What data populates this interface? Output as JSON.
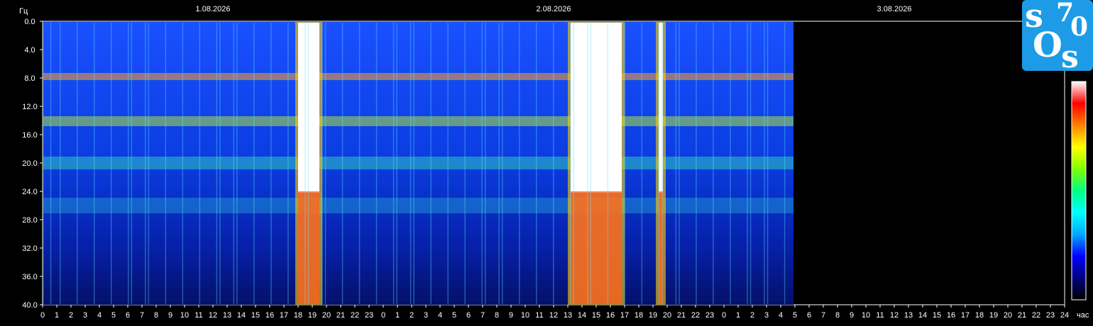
{
  "chart_data": {
    "type": "heatmap",
    "title": "",
    "ylabel": "Гц",
    "xlabel": "час",
    "ylim": [
      0,
      40
    ],
    "y_ticks": [
      "0.0",
      "4.0",
      "8.0",
      "12.0",
      "16.0",
      "20.0",
      "24.0",
      "28.0",
      "32.0",
      "36.0",
      "40.0"
    ],
    "dates": [
      "1.08.2026",
      "2.08.2026",
      "3.08.2026"
    ],
    "x_ticks": [
      "0",
      "1",
      "2",
      "3",
      "4",
      "5",
      "6",
      "7",
      "8",
      "9",
      "10",
      "11",
      "12",
      "13",
      "14",
      "15",
      "16",
      "17",
      "18",
      "19",
      "20",
      "21",
      "22",
      "23",
      "0",
      "1",
      "2",
      "3",
      "4",
      "5",
      "6",
      "7",
      "8",
      "9",
      "10",
      "11",
      "12",
      "13",
      "14",
      "15",
      "16",
      "17",
      "18",
      "19",
      "20",
      "21",
      "22",
      "23",
      "0",
      "1",
      "2",
      "3",
      "4",
      "5",
      "6",
      "7",
      "8",
      "9",
      "10",
      "11",
      "12",
      "13",
      "14",
      "15",
      "16",
      "17",
      "18",
      "19",
      "20",
      "21",
      "22",
      "23",
      "24"
    ],
    "data_end_hours": 52.9,
    "resonance_bands_hz": [
      7.8,
      14.1,
      20.0,
      26.0
    ],
    "bursts": [
      {
        "start_h": 18.0,
        "end_h": 19.5,
        "intensity": "white"
      },
      {
        "start_h": 37.2,
        "end_h": 40.8,
        "intensity": "white"
      },
      {
        "start_h": 43.4,
        "end_h": 43.7,
        "intensity": "white"
      }
    ],
    "colorscale": [
      "#000000",
      "#000080",
      "#0000ff",
      "#00aaff",
      "#00ffff",
      "#00ff80",
      "#80ff00",
      "#ffff00",
      "#ff8000",
      "#ff0000",
      "#ffffff"
    ]
  },
  "logo": {
    "letters": [
      "s",
      "7",
      "0",
      "O",
      "s"
    ],
    "color": "#1e9be6"
  }
}
